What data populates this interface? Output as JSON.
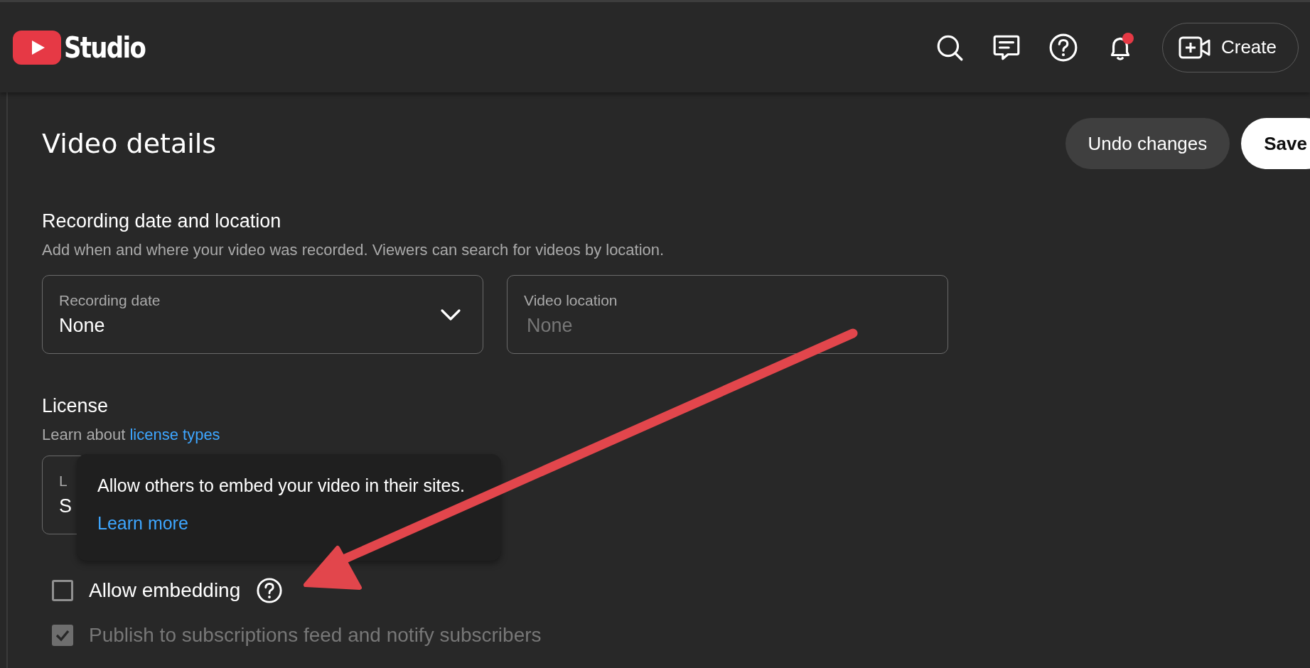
{
  "header": {
    "logo_text": "Studio",
    "has_notification": true,
    "create_label": "Create"
  },
  "page": {
    "title": "Video details",
    "buttons": [
      {
        "label": "Undo changes",
        "kind": "secondary"
      },
      {
        "label": "Save",
        "kind": "primary"
      }
    ]
  },
  "recording": {
    "title": "Recording date and location",
    "description": "Add when and where your video was recorded. Viewers can search for videos by location.",
    "fields": [
      {
        "label": "Recording date",
        "value": "None",
        "kind": "dropdown"
      },
      {
        "label": "Video location",
        "placeholder": "None",
        "kind": "text"
      }
    ]
  },
  "license": {
    "title": "License",
    "description": "Learn about",
    "link": "license types",
    "field": {
      "label": "L",
      "value": "S"
    }
  },
  "tooltip": {
    "text": "Allow others to embed your video in their sites.",
    "link": "Learn more"
  },
  "options": [
    {
      "label": "Allow embedding",
      "checked": false,
      "disabled": false,
      "help": true
    },
    {
      "label": "Publish to subscriptions feed and notify subscribers",
      "checked": true,
      "disabled": true
    }
  ]
}
